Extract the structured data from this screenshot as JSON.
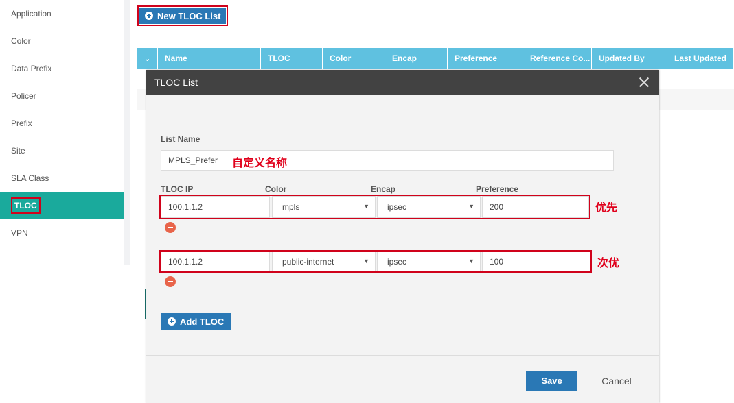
{
  "sidebar": {
    "items": [
      {
        "label": "Application"
      },
      {
        "label": "Color"
      },
      {
        "label": "Data Prefix"
      },
      {
        "label": "Policer"
      },
      {
        "label": "Prefix"
      },
      {
        "label": "Site"
      },
      {
        "label": "SLA Class"
      },
      {
        "label": "TLOC"
      },
      {
        "label": "VPN"
      }
    ],
    "active": "TLOC"
  },
  "toolbar": {
    "new_list_label": "New TLOC List"
  },
  "table": {
    "columns": [
      "Name",
      "TLOC",
      "Color",
      "Encap",
      "Preference",
      "Reference Co...",
      "Updated By",
      "Last Updated"
    ]
  },
  "modal": {
    "title": "TLOC List",
    "list_name_label": "List Name",
    "list_name_value": "MPLS_Prefer",
    "list_name_annotation": "自定义名称",
    "col_labels": {
      "tloc_ip": "TLOC IP",
      "color": "Color",
      "encap": "Encap",
      "preference": "Preference"
    },
    "rows": [
      {
        "ip": "100.1.1.2",
        "color": "mpls",
        "encap": "ipsec",
        "preference": "200",
        "annotation": "优先"
      },
      {
        "ip": "100.1.1.2",
        "color": "public-internet",
        "encap": "ipsec",
        "preference": "100",
        "annotation": "次优"
      }
    ],
    "add_label": "Add TLOC",
    "save_label": "Save",
    "cancel_label": "Cancel"
  },
  "colors": {
    "accent": "#2a78b5",
    "active": "#1aaa9c",
    "header": "#5fc1e0",
    "highlight": "#d0021b"
  }
}
